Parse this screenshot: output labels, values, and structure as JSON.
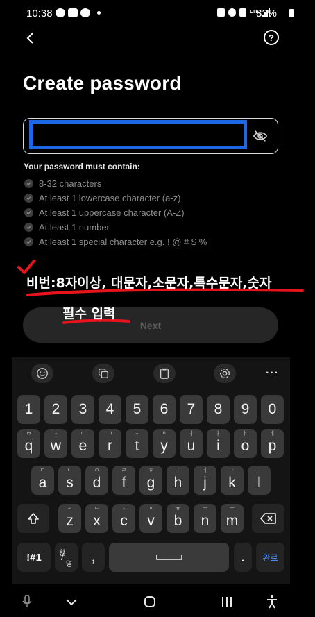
{
  "status_bar": {
    "time": "10:38",
    "battery": "82%",
    "network": "LTE"
  },
  "header": {
    "help_label": "?"
  },
  "title": "Create password",
  "password_input": {
    "value": "",
    "placeholder": ""
  },
  "requirements": {
    "heading": "Your password must contain:",
    "items": [
      "8-32 characters",
      "At least 1 lowercase character (a-z)",
      "At least 1 uppercase character (A-Z)",
      "At least 1 number",
      "At least 1 special character e.g. ! @ # $ %"
    ]
  },
  "annotation": {
    "line1": "비번:8자이상, 대문자,소문자,특수문자,숫자",
    "line2": "필수 입력",
    "color": "#e8141c"
  },
  "next_button": {
    "label": "Next"
  },
  "keyboard": {
    "numbers": [
      "1",
      "2",
      "3",
      "4",
      "5",
      "6",
      "7",
      "8",
      "9",
      "0"
    ],
    "row1": [
      {
        "k": "q",
        "h": "ㅂ"
      },
      {
        "k": "w",
        "h": "ㅈ"
      },
      {
        "k": "e",
        "h": "ㄷ"
      },
      {
        "k": "r",
        "h": "ㄱ"
      },
      {
        "k": "t",
        "h": "ㅅ"
      },
      {
        "k": "y",
        "h": "ㅛ"
      },
      {
        "k": "u",
        "h": "ㅕ"
      },
      {
        "k": "i",
        "h": "ㅑ"
      },
      {
        "k": "o",
        "h": "ㅐ"
      },
      {
        "k": "p",
        "h": "ㅔ"
      }
    ],
    "row2": [
      {
        "k": "a",
        "h": "ㅁ"
      },
      {
        "k": "s",
        "h": "ㄴ"
      },
      {
        "k": "d",
        "h": "ㅇ"
      },
      {
        "k": "f",
        "h": "ㄹ"
      },
      {
        "k": "g",
        "h": "ㅎ"
      },
      {
        "k": "h",
        "h": "ㅗ"
      },
      {
        "k": "j",
        "h": "ㅓ"
      },
      {
        "k": "k",
        "h": "ㅏ"
      },
      {
        "k": "l",
        "h": "ㅣ"
      }
    ],
    "row3": [
      {
        "k": "z",
        "h": "ㅋ"
      },
      {
        "k": "x",
        "h": "ㅌ"
      },
      {
        "k": "c",
        "h": "ㅊ"
      },
      {
        "k": "v",
        "h": "ㅍ"
      },
      {
        "k": "b",
        "h": "ㅠ"
      },
      {
        "k": "n",
        "h": "ㅜ"
      },
      {
        "k": "m",
        "h": "ㅡ"
      }
    ],
    "symbols_label": "!#1",
    "lang_top": "한",
    "lang_bottom": "영",
    "comma": ",",
    "period": ".",
    "done_label": "완료",
    "accent_color": "#4e97ff"
  }
}
